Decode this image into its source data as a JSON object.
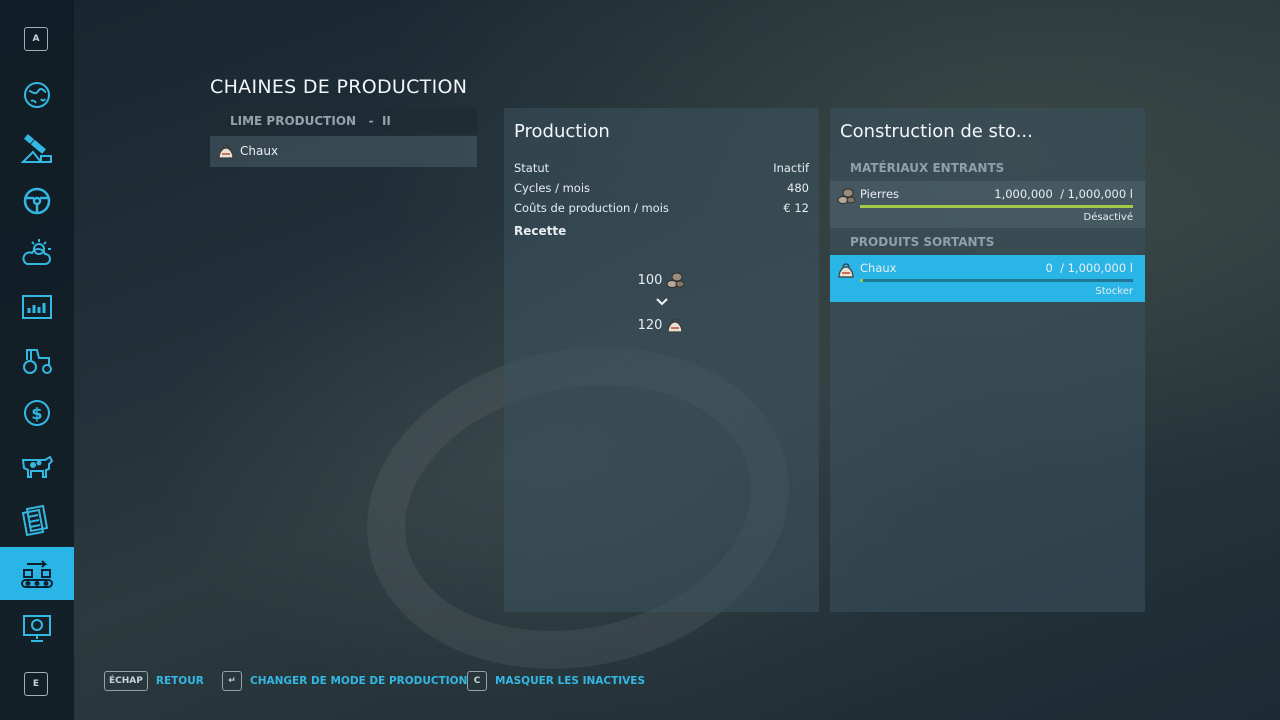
{
  "page_title": "CHAINES DE PRODUCTION",
  "sidebar": {
    "top_key": "A",
    "bottom_key": "E",
    "items": [
      {
        "icon": "globe-map-icon"
      },
      {
        "icon": "satellite-icon"
      },
      {
        "icon": "steering-wheel-icon"
      },
      {
        "icon": "weather-sun-cloud-icon"
      },
      {
        "icon": "statistics-chart-icon"
      },
      {
        "icon": "tractor-icon"
      },
      {
        "icon": "dollar-coin-icon"
      },
      {
        "icon": "cow-icon"
      },
      {
        "icon": "contracts-papers-icon"
      },
      {
        "icon": "production-conveyor-icon",
        "active": true
      },
      {
        "icon": "help-presentation-icon"
      }
    ],
    "accent_color": "#29b6e6"
  },
  "production_list": {
    "header": "LIME PRODUCTION   -  II",
    "items": [
      {
        "label": "Chaux",
        "icon": "lime-sack-icon"
      }
    ]
  },
  "production": {
    "title": "Production",
    "stats": [
      {
        "label": "Statut",
        "value": "Inactif"
      },
      {
        "label": "Cycles / mois",
        "value": "480"
      },
      {
        "label": "Coûts de production / mois",
        "value": "€ 12"
      }
    ],
    "recipe_label": "Recette",
    "recipe": {
      "input_amount": "100",
      "input_icon": "stones-icon",
      "arrow_icon": "chevron-down-icon",
      "output_amount": "120",
      "output_icon": "lime-sack-icon"
    }
  },
  "storage": {
    "title": "Construction de sto...",
    "inputs_header": "MATÉRIAUX ENTRANTS",
    "inputs": [
      {
        "name": "Pierres",
        "amount": "1,000,000  / 1,000,000 l",
        "status": "Désactivé",
        "fill": 1.0,
        "icon": "stones-icon"
      }
    ],
    "outputs_header": "PRODUITS SORTANTS",
    "outputs": [
      {
        "name": "Chaux",
        "amount": "0  / 1,000,000 l",
        "status": "Stocker",
        "fill": 0.0,
        "icon": "lime-sack-icon"
      }
    ],
    "bar_color": "#a3c94a"
  },
  "bottom_bar": [
    {
      "key": "ÉCHAP",
      "label": "RETOUR"
    },
    {
      "key": "↵",
      "label": "CHANGER DE MODE DE PRODUCTION"
    },
    {
      "key": "C",
      "label": "MASQUER LES INACTIVES"
    }
  ]
}
